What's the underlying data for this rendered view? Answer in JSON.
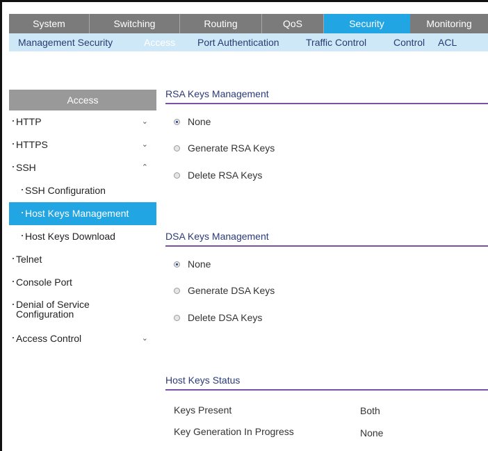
{
  "top_tabs": [
    {
      "label": "System",
      "active": false
    },
    {
      "label": "Switching",
      "active": false
    },
    {
      "label": "Routing",
      "active": false
    },
    {
      "label": "QoS",
      "active": false
    },
    {
      "label": "Security",
      "active": true
    },
    {
      "label": "Monitoring",
      "active": false
    }
  ],
  "sub_tabs": [
    {
      "label": "Management Security",
      "active": false
    },
    {
      "label": "Access",
      "active": true
    },
    {
      "label": "Port Authentication",
      "active": false
    },
    {
      "label": "Traffic Control",
      "active": false
    },
    {
      "label": "Control",
      "active": false
    },
    {
      "label": "ACL",
      "active": false
    }
  ],
  "sidebar": {
    "header": "Access",
    "items": [
      {
        "label": "HTTP",
        "chevron": "⌄"
      },
      {
        "label": "HTTPS",
        "chevron": "⌄"
      },
      {
        "label": "SSH",
        "chevron": "⌃"
      },
      {
        "label": "SSH Configuration"
      },
      {
        "label": "Host Keys Management"
      },
      {
        "label": "Host Keys Download"
      },
      {
        "label": "Telnet"
      },
      {
        "label": "Console Port"
      },
      {
        "label": "Denial of Service Configuration"
      },
      {
        "label": "Access Control",
        "chevron": "⌄"
      }
    ]
  },
  "rsa": {
    "title": "RSA Keys Management",
    "options": [
      "None",
      "Generate RSA Keys",
      "Delete RSA Keys"
    ],
    "selected": "None"
  },
  "dsa": {
    "title": "DSA Keys Management",
    "options": [
      "None",
      "Generate DSA Keys",
      "Delete DSA Keys"
    ],
    "selected": "None"
  },
  "status": {
    "title": "Host Keys Status",
    "rows": [
      {
        "label": "Keys Present",
        "value": "Both"
      },
      {
        "label": "Key Generation In Progress",
        "value": "None"
      }
    ]
  },
  "colors": {
    "accent": "#22a5e3",
    "section_rule": "#7b4fa7",
    "subnav_bg": "#cfe8f8"
  }
}
